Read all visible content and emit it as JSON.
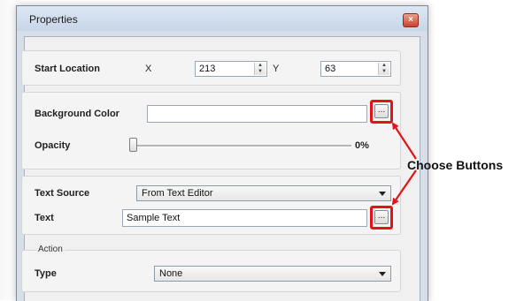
{
  "window": {
    "title": "Properties",
    "close_glyph": "×"
  },
  "start_location": {
    "label": "Start Location",
    "x_label": "X",
    "x_value": "213",
    "y_label": "Y",
    "y_value": "63"
  },
  "background": {
    "label": "Background Color",
    "value": "",
    "choose_label": "...",
    "opacity_label": "Opacity",
    "opacity_value": "0%",
    "opacity_fraction": 0
  },
  "text": {
    "source_label": "Text Source",
    "source_value": "From Text Editor",
    "text_label": "Text",
    "text_value": "Sample Text",
    "choose_label": "..."
  },
  "action": {
    "group_label": "Action",
    "type_label": "Type",
    "type_value": "None"
  },
  "annotation": {
    "text": "Choose Buttons",
    "color": "#e0141a"
  },
  "icons": {
    "spin": "spin-arrows-icon",
    "dropdown": "chevron-down-icon",
    "close": "close-icon"
  }
}
